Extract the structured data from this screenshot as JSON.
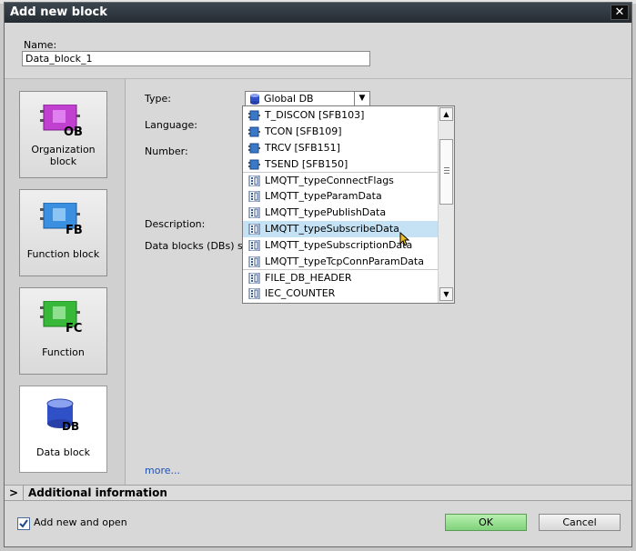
{
  "dialog": {
    "title": "Add new block",
    "close_label": "✕"
  },
  "name_field": {
    "label": "Name:",
    "value": "Data_block_1"
  },
  "blocks": [
    {
      "label": "Organization block",
      "badge": "OB",
      "color": "#c040d0"
    },
    {
      "label": "Function block",
      "badge": "FB",
      "color": "#3a8fe0"
    },
    {
      "label": "Function",
      "badge": "FC",
      "color": "#38b838"
    },
    {
      "label": "Data block",
      "badge": "DB",
      "color": "#3050c8"
    }
  ],
  "form": {
    "type_label": "Type:",
    "type_value": "Global DB",
    "language_label": "Language:",
    "number_label": "Number:",
    "description_label": "Description:",
    "description_text": "Data blocks (DBs) sa"
  },
  "dropdown": {
    "items": [
      {
        "label": "T_DISCON  [SFB103]",
        "icon": "sfb-icon"
      },
      {
        "label": "TCON  [SFB109]",
        "icon": "sfb-icon"
      },
      {
        "label": "TRCV  [SFB151]",
        "icon": "sfb-icon"
      },
      {
        "label": "TSEND  [SFB150]",
        "icon": "sfb-icon"
      },
      {
        "label": "LMQTT_typeConnectFlags",
        "icon": "udt-icon"
      },
      {
        "label": "LMQTT_typeParamData",
        "icon": "udt-icon"
      },
      {
        "label": "LMQTT_typePublishData",
        "icon": "udt-icon"
      },
      {
        "label": "LMQTT_typeSubscribeData",
        "icon": "udt-icon"
      },
      {
        "label": "LMQTT_typeSubscriptionData",
        "icon": "udt-icon"
      },
      {
        "label": "LMQTT_typeTcpConnParamData",
        "icon": "udt-icon"
      },
      {
        "label": "FILE_DB_HEADER",
        "icon": "udt-icon"
      },
      {
        "label": "IEC_COUNTER",
        "icon": "udt-icon"
      }
    ],
    "hovered": "LMQTT_typeSubscribeData"
  },
  "more_link": "more...",
  "additional_info": {
    "chevron": ">",
    "label": "Additional  information"
  },
  "footer": {
    "checkbox_label": "Add new and open",
    "checkbox_checked": true,
    "ok_label": "OK",
    "cancel_label": "Cancel"
  },
  "colors": {
    "accent": "#3a8fe0",
    "ok": "#7fd27a",
    "hover": "#c4e2f4"
  }
}
